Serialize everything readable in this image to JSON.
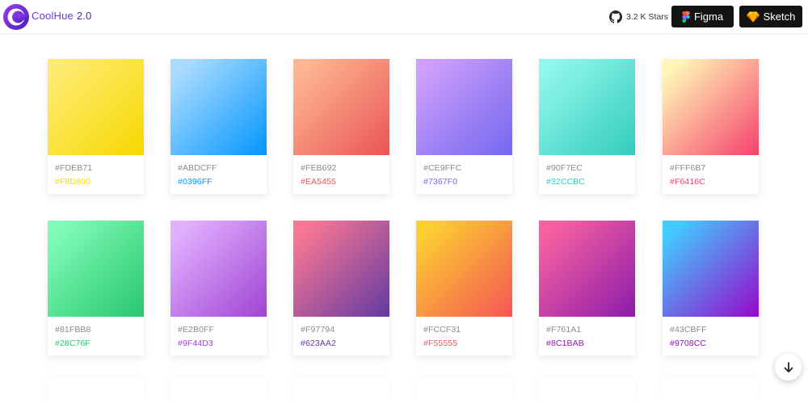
{
  "brand": {
    "name": "CoolHue",
    "version": "2.0",
    "logo_icon": "coolhue-logo-icon",
    "accent": "#6a3bd2"
  },
  "header": {
    "github": {
      "icon": "github-icon",
      "label": "3.2 K Stars"
    },
    "figma_button": {
      "icon": "figma-icon",
      "label": "Figma"
    },
    "sketch_button": {
      "icon": "sketch-icon",
      "label": "Sketch"
    }
  },
  "gradients": [
    {
      "from": "#FDEB71",
      "to": "#F8D800"
    },
    {
      "from": "#ABDCFF",
      "to": "#0396FF"
    },
    {
      "from": "#FEB692",
      "to": "#EA5455"
    },
    {
      "from": "#CE9FFC",
      "to": "#7367F0"
    },
    {
      "from": "#90F7EC",
      "to": "#32CCBC"
    },
    {
      "from": "#FFF6B7",
      "to": "#F6416C"
    },
    {
      "from": "#81FBB8",
      "to": "#28C76F"
    },
    {
      "from": "#E2B0FF",
      "to": "#9F44D3"
    },
    {
      "from": "#F97794",
      "to": "#623AA2"
    },
    {
      "from": "#FCCF31",
      "to": "#F55555"
    },
    {
      "from": "#F761A1",
      "to": "#8C1BAB"
    },
    {
      "from": "#43CBFF",
      "to": "#9708CC"
    }
  ],
  "scroll_button": {
    "icon": "arrow-down-icon"
  }
}
